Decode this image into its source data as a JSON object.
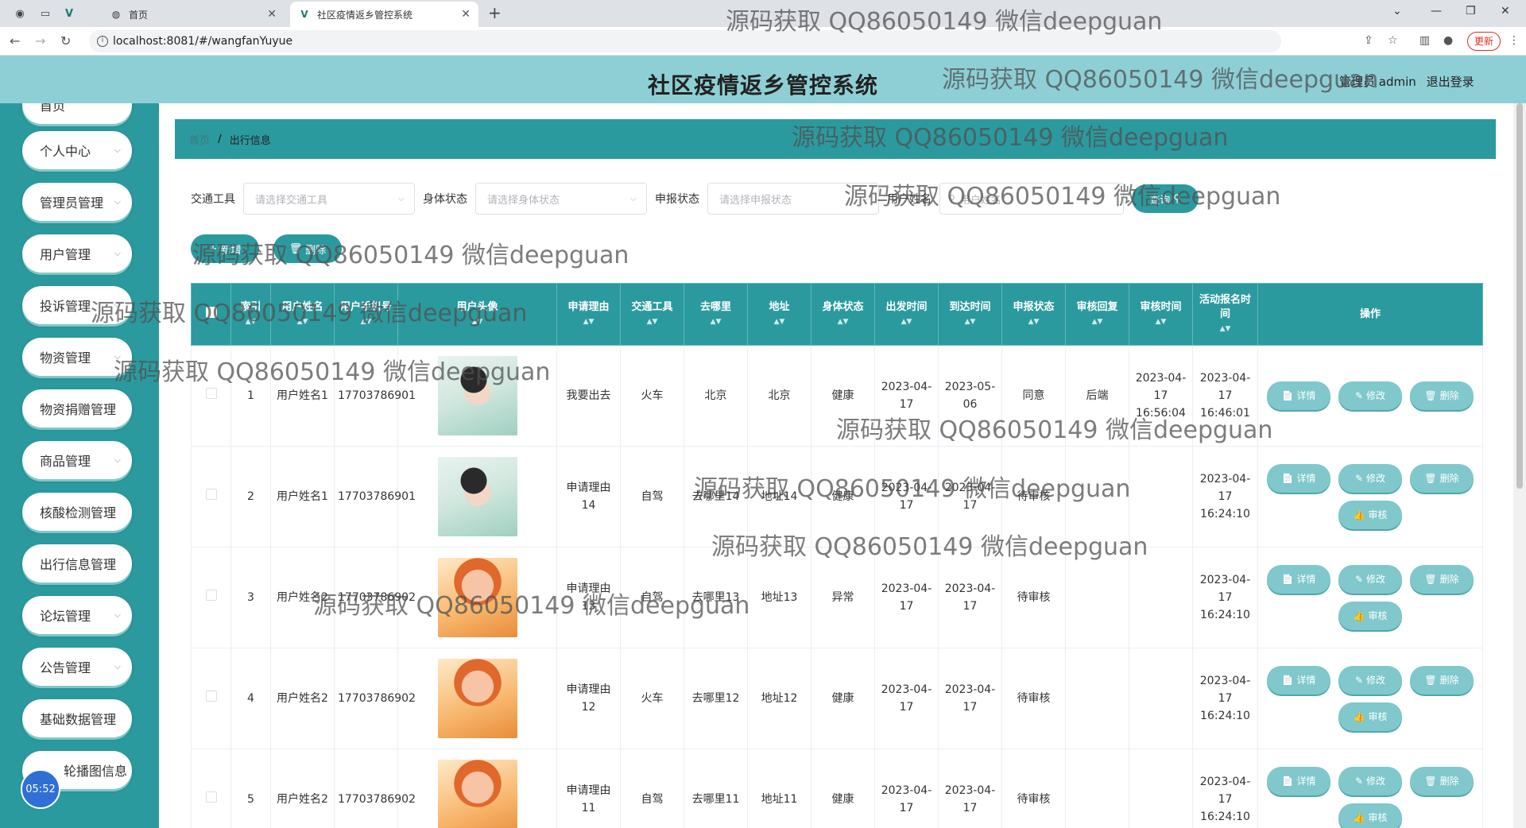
{
  "browser": {
    "tabs": [
      {
        "title": "首页",
        "active": false
      },
      {
        "title": "社区疫情返乡管控系统",
        "active": true
      }
    ],
    "url": "localhost:8081/#/wangfanYuyue",
    "update_label": "更新"
  },
  "header": {
    "title": "社区疫情返乡管控系统",
    "admin_label": "管理员 admin",
    "logout_label": "退出登录"
  },
  "sidebar": {
    "items": [
      {
        "label": "首页",
        "has_chevron": false
      },
      {
        "label": "个人中心",
        "has_chevron": true
      },
      {
        "label": "管理员管理",
        "has_chevron": true
      },
      {
        "label": "用户管理",
        "has_chevron": true
      },
      {
        "label": "投诉管理",
        "has_chevron": true
      },
      {
        "label": "物资管理",
        "has_chevron": true
      },
      {
        "label": "物资捐赠管理",
        "has_chevron": false
      },
      {
        "label": "商品管理",
        "has_chevron": true
      },
      {
        "label": "核酸检测管理",
        "has_chevron": false
      },
      {
        "label": "出行信息管理",
        "has_chevron": false
      },
      {
        "label": "论坛管理",
        "has_chevron": true
      },
      {
        "label": "公告管理",
        "has_chevron": true
      },
      {
        "label": "基础数据管理",
        "has_chevron": false
      },
      {
        "label": "轮播图信息",
        "has_chevron": true
      }
    ],
    "timer": "05:52"
  },
  "breadcrumb": {
    "home": "首页",
    "separator": "/",
    "current": "出行信息"
  },
  "filters": {
    "transport": {
      "label": "交通工具",
      "placeholder": "请选择交通工具"
    },
    "health": {
      "label": "身体状态",
      "placeholder": "请选择身体状态"
    },
    "report": {
      "label": "申报状态",
      "placeholder": "请选择申报状态"
    },
    "username": {
      "label": "用户姓名",
      "placeholder": "用户姓名"
    },
    "query_label": "查询"
  },
  "actions": {
    "add_label": "新增",
    "delete_label": "删除"
  },
  "table": {
    "headers": [
      "索引",
      "用户姓名",
      "用户手机号",
      "用户头像",
      "申请理由",
      "交通工具",
      "去哪里",
      "地址",
      "身体状态",
      "出发时间",
      "到达时间",
      "申报状态",
      "审核回复",
      "审核时间",
      "活动报名时间",
      "操作"
    ],
    "op_labels": {
      "detail": "详情",
      "edit": "修改",
      "delete": "删除",
      "audit": "审核"
    },
    "rows": [
      {
        "index": "1",
        "name": "用户姓名1",
        "phone": "17703786901",
        "reason": "我要出去",
        "transport": "火车",
        "dest": "北京",
        "addr": "北京",
        "health": "健康",
        "depart": "2023-04-17",
        "arrive": "2023-05-06",
        "status": "同意",
        "reply": "后端",
        "audit_time": "2023-04-17 16:56:04",
        "signup_time": "2023-04-17 16:46:01",
        "audit": false
      },
      {
        "index": "2",
        "name": "用户姓名1",
        "phone": "17703786901",
        "reason": "申请理由14",
        "transport": "自驾",
        "dest": "去哪里14",
        "addr": "地址14",
        "health": "健康",
        "depart": "2023-04-17",
        "arrive": "2023-04-17",
        "status": "待审核",
        "reply": "",
        "audit_time": "",
        "signup_time": "2023-04-17 16:24:10",
        "audit": true
      },
      {
        "index": "3",
        "name": "用户姓名2",
        "phone": "17703786902",
        "reason": "申请理由13",
        "transport": "自驾",
        "dest": "去哪里13",
        "addr": "地址13",
        "health": "异常",
        "depart": "2023-04-17",
        "arrive": "2023-04-17",
        "status": "待审核",
        "reply": "",
        "audit_time": "",
        "signup_time": "2023-04-17 16:24:10",
        "audit": true
      },
      {
        "index": "4",
        "name": "用户姓名2",
        "phone": "17703786902",
        "reason": "申请理由12",
        "transport": "火车",
        "dest": "去哪里12",
        "addr": "地址12",
        "health": "健康",
        "depart": "2023-04-17",
        "arrive": "2023-04-17",
        "status": "待审核",
        "reply": "",
        "audit_time": "",
        "signup_time": "2023-04-17 16:24:10",
        "audit": true
      },
      {
        "index": "5",
        "name": "用户姓名2",
        "phone": "17703786902",
        "reason": "申请理由11",
        "transport": "自驾",
        "dest": "去哪里11",
        "addr": "地址11",
        "health": "健康",
        "depart": "2023-04-17",
        "arrive": "2023-04-17",
        "status": "待审核",
        "reply": "",
        "audit_time": "",
        "signup_time": "2023-04-17 16:24:10",
        "audit": true
      }
    ]
  },
  "watermark": "源码获取 QQ86050149 微信deepguan",
  "colors": {
    "teal": "#2b9a9e",
    "header": "#8ecfd6",
    "op_button": "#80c8cb"
  }
}
